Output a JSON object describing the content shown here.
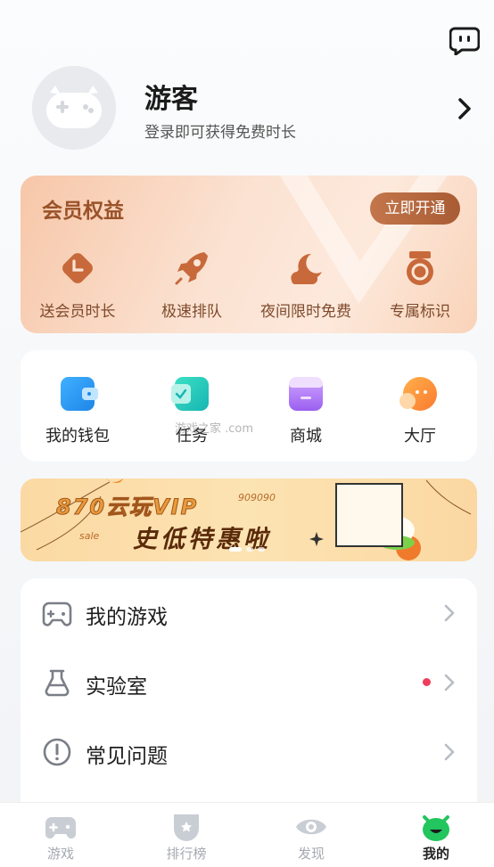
{
  "header": {
    "message_icon": "chat-bubble-icon"
  },
  "profile": {
    "avatar_icon": "gamepad-robot-avatar",
    "username": "游客",
    "subtitle": "登录即可获得免费时长"
  },
  "vip": {
    "title": "会员权益",
    "open_button": "立即开通",
    "benefits": [
      {
        "label": "送会员时长",
        "icon": "clock-diamond-icon"
      },
      {
        "label": "极速排队",
        "icon": "rocket-icon"
      },
      {
        "label": "夜间限时免费",
        "icon": "moon-cloud-icon"
      },
      {
        "label": "专属标识",
        "icon": "medal-icon"
      }
    ],
    "accent": "#9a5229"
  },
  "tools": [
    {
      "label": "我的钱包",
      "icon": "wallet-icon",
      "color": "#2d9bf0"
    },
    {
      "label": "任务",
      "icon": "task-check-icon",
      "color": "#1fc7b3"
    },
    {
      "label": "商城",
      "icon": "shop-icon",
      "color": "#a36cf2"
    },
    {
      "label": "大厅",
      "icon": "chat-hall-icon",
      "color": "#fa8a3c"
    }
  ],
  "banner": {
    "title": "870云玩VIP",
    "subtitle": "史低特惠啦",
    "sale": "sale",
    "number": "909090"
  },
  "menu": [
    {
      "label": "我的游戏",
      "icon": "gamepad-icon",
      "has_dot": false
    },
    {
      "label": "实验室",
      "icon": "flask-icon",
      "has_dot": true
    },
    {
      "label": "常见问题",
      "icon": "exclamation-circle-icon",
      "has_dot": false
    }
  ],
  "watermark": "游戏之家 .com",
  "bottom_nav": [
    {
      "label": "游戏",
      "icon": "gamepad-tab-icon",
      "active": false
    },
    {
      "label": "排行榜",
      "icon": "ranking-shield-icon",
      "active": false
    },
    {
      "label": "发现",
      "icon": "eye-icon",
      "active": false
    },
    {
      "label": "我的",
      "icon": "mascot-tab-icon",
      "active": true
    }
  ]
}
